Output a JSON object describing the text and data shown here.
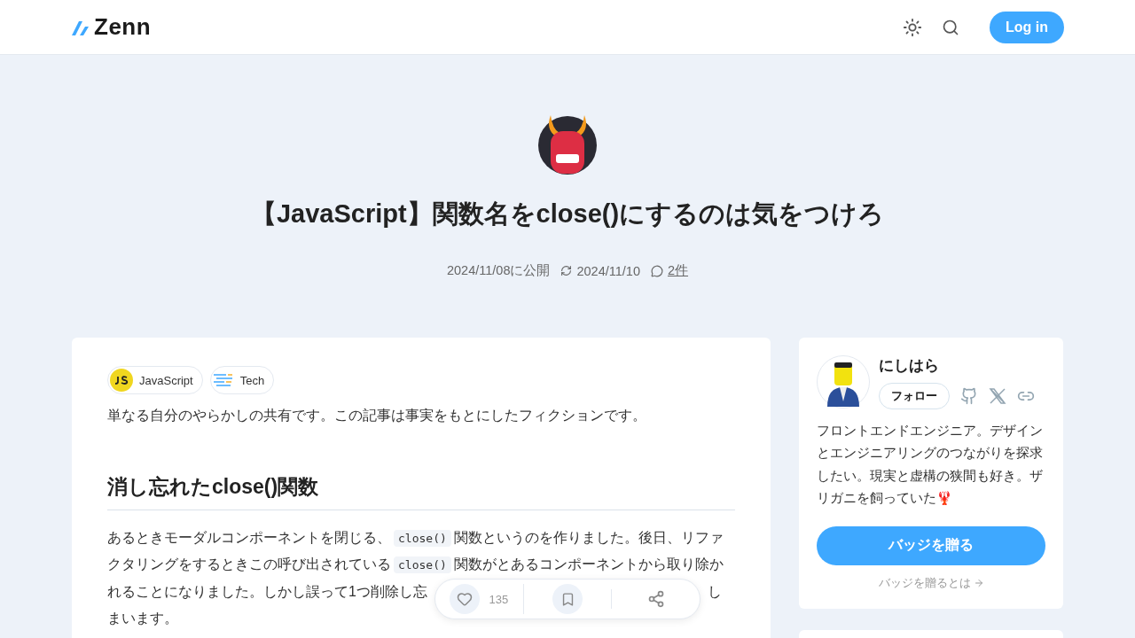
{
  "header": {
    "logo": "Zenn",
    "login": "Log in"
  },
  "article": {
    "title": "【JavaScript】関数名をclose()にするのは気をつけろ",
    "published": "2024/11/08に公開",
    "updated": "2024/11/10",
    "comments": "2件"
  },
  "topics": [
    {
      "kind": "js",
      "label": "JavaScript"
    },
    {
      "kind": "tech",
      "label": "Tech"
    }
  ],
  "intro": "単なる自分のやらかしの共有です。この記事は事実をもとにしたフィクションです。",
  "heading": "消し忘れたclose()関数",
  "paragraph": {
    "segments": [
      {
        "kind": "text",
        "text": "あるときモーダルコンポーネントを閉じる、"
      },
      {
        "kind": "code",
        "text": "close()"
      },
      {
        "kind": "text",
        "text": "関数というのを作りました。後日、リファクタリングをするときこの呼び出されている"
      },
      {
        "kind": "code",
        "text": "close()"
      },
      {
        "kind": "text",
        "text": "関数がとあるコンポーネントから取り除かれることになりました。しかし誤って1つ削除し忘"
      }
    ],
    "after_cover": "しまいます。"
  },
  "actions": {
    "likes": "135"
  },
  "author": {
    "name": "にしはら",
    "follow": "フォロー",
    "bio": "フロントエンドエンジニア。デザインとエンジニアリングのつながりを探求したい。現実と虚構の狭間も好き。ザリガニを飼っていた🦞",
    "badge": "バッジを贈る",
    "badge_link": "バッジを贈るとは"
  }
}
